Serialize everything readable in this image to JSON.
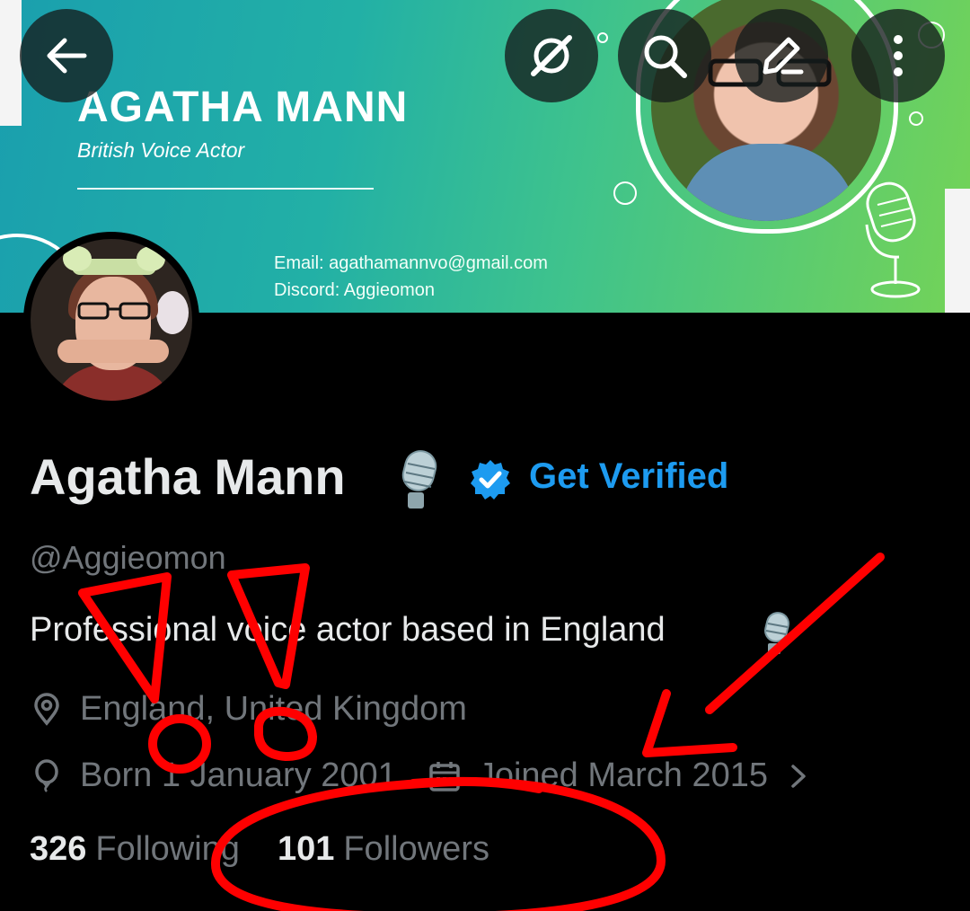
{
  "banner": {
    "title": "AGATHA MANN",
    "subtitle": "British Voice Actor",
    "email": "Email: agathamannvo@gmail.com",
    "discord": "Discord: Aggieomon"
  },
  "toolbar": {
    "back_icon": "arrow-left-icon",
    "grok_icon": "grok-icon",
    "search_icon": "search-icon",
    "edit_icon": "pencil-icon",
    "more_icon": "more-vertical-icon"
  },
  "profile": {
    "display_name": "Agatha Mann",
    "name_emoji": "microphone-icon",
    "get_verified": "Get Verified",
    "handle": "@Aggieomon",
    "bio": "Professional voice actor based in England",
    "location": "England, United Kingdom",
    "birthday": "Born 1 January 2001",
    "joined": "Joined March 2015"
  },
  "stats": {
    "following_count": "326",
    "following_label": "Following",
    "followers_count": "101",
    "followers_label": "Followers"
  },
  "colors": {
    "accent_blue": "#1d9bf0",
    "annotation_red": "#ff0000",
    "text_primary": "#e7e9ea",
    "text_secondary": "#71767b"
  }
}
